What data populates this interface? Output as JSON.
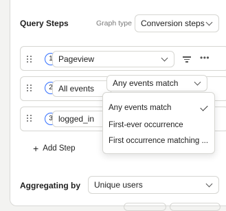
{
  "query_steps": {
    "title": "Query Steps",
    "graph_type_label": "Graph type",
    "graph_type_value": "Conversion steps"
  },
  "steps": [
    {
      "number": "1",
      "event": "Pageview",
      "filter_icon": "filter-icon",
      "more_icon": "more-horizontal-icon"
    },
    {
      "number": "2",
      "event": "All events"
    },
    {
      "number": "3",
      "event": "logged_in"
    }
  ],
  "match_select": {
    "value": "Any events match"
  },
  "match_menu": {
    "options": [
      "Any events match",
      "First-ever occurrence",
      "First occurrence matching ..."
    ],
    "selected": "Any events match"
  },
  "add_step_label": "Add Step",
  "aggregating": {
    "label": "Aggregating by",
    "value": "Unique users"
  },
  "colors": {
    "accent": "#2f6dff",
    "border": "#d6d6d2",
    "background": "#f3f3f1"
  }
}
